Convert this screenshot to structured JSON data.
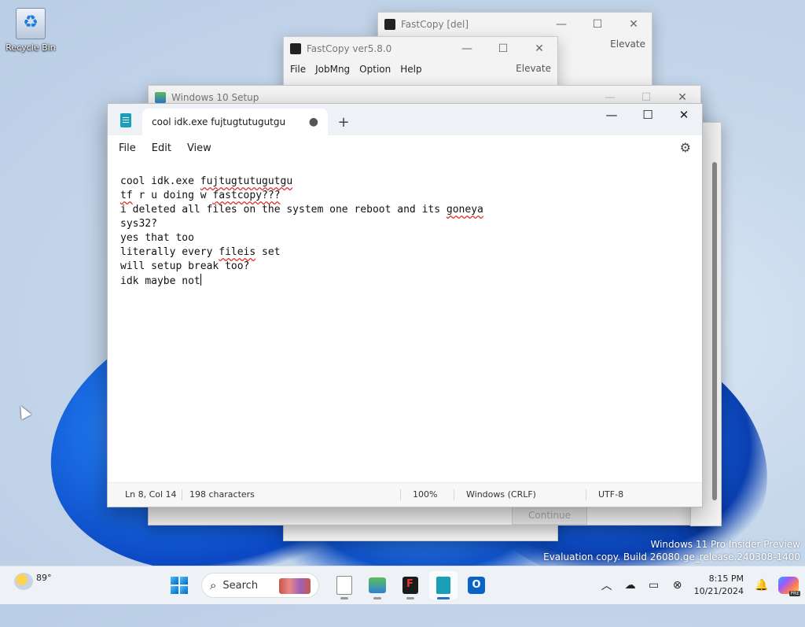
{
  "desktop": {
    "recycle_bin_label": "Recycle Bin"
  },
  "windows": {
    "fastcopy_del": {
      "title": "FastCopy [del]",
      "elevate": "Elevate"
    },
    "fastcopy_main": {
      "title": "FastCopy ver5.8.0",
      "menu": [
        "File",
        "JobMng",
        "Option",
        "Help"
      ],
      "elevate": "Elevate"
    },
    "setup": {
      "title": "Windows 10 Setup",
      "continue_label": "Continue"
    }
  },
  "notepad": {
    "tab_title": "cool idk.exe fujtugtutugutgu",
    "tab_unsaved_marker": "●",
    "new_tab_label": "+",
    "menu": [
      "File",
      "Edit",
      "View"
    ],
    "lines": [
      "cool idk.exe fujtugtutugutgu",
      "tf r u doing w fastcopy???",
      "i deleted all files on the system one reboot and its goneya",
      "sys32?",
      "yes that too",
      "literally every fileis set",
      "will setup break too?",
      "idk maybe not"
    ],
    "status": {
      "position": "Ln 8, Col 14",
      "characters": "198 characters",
      "zoom": "100%",
      "line_ending": "Windows (CRLF)",
      "encoding": "UTF-8"
    }
  },
  "watermark": {
    "line1": "Windows 11 Pro Insider Preview",
    "line2": "Evaluation copy. Build 26080.ge_release.240308-1400"
  },
  "taskbar": {
    "weather_temp": "89°",
    "search_placeholder": "Search",
    "time": "8:15 PM",
    "date": "10/21/2024"
  },
  "icons": {
    "minimize": "—",
    "maximize": "☐",
    "close": "✕",
    "gear": "⚙",
    "search": "⌕",
    "chevron_up": "︿",
    "bell": "🔔"
  }
}
